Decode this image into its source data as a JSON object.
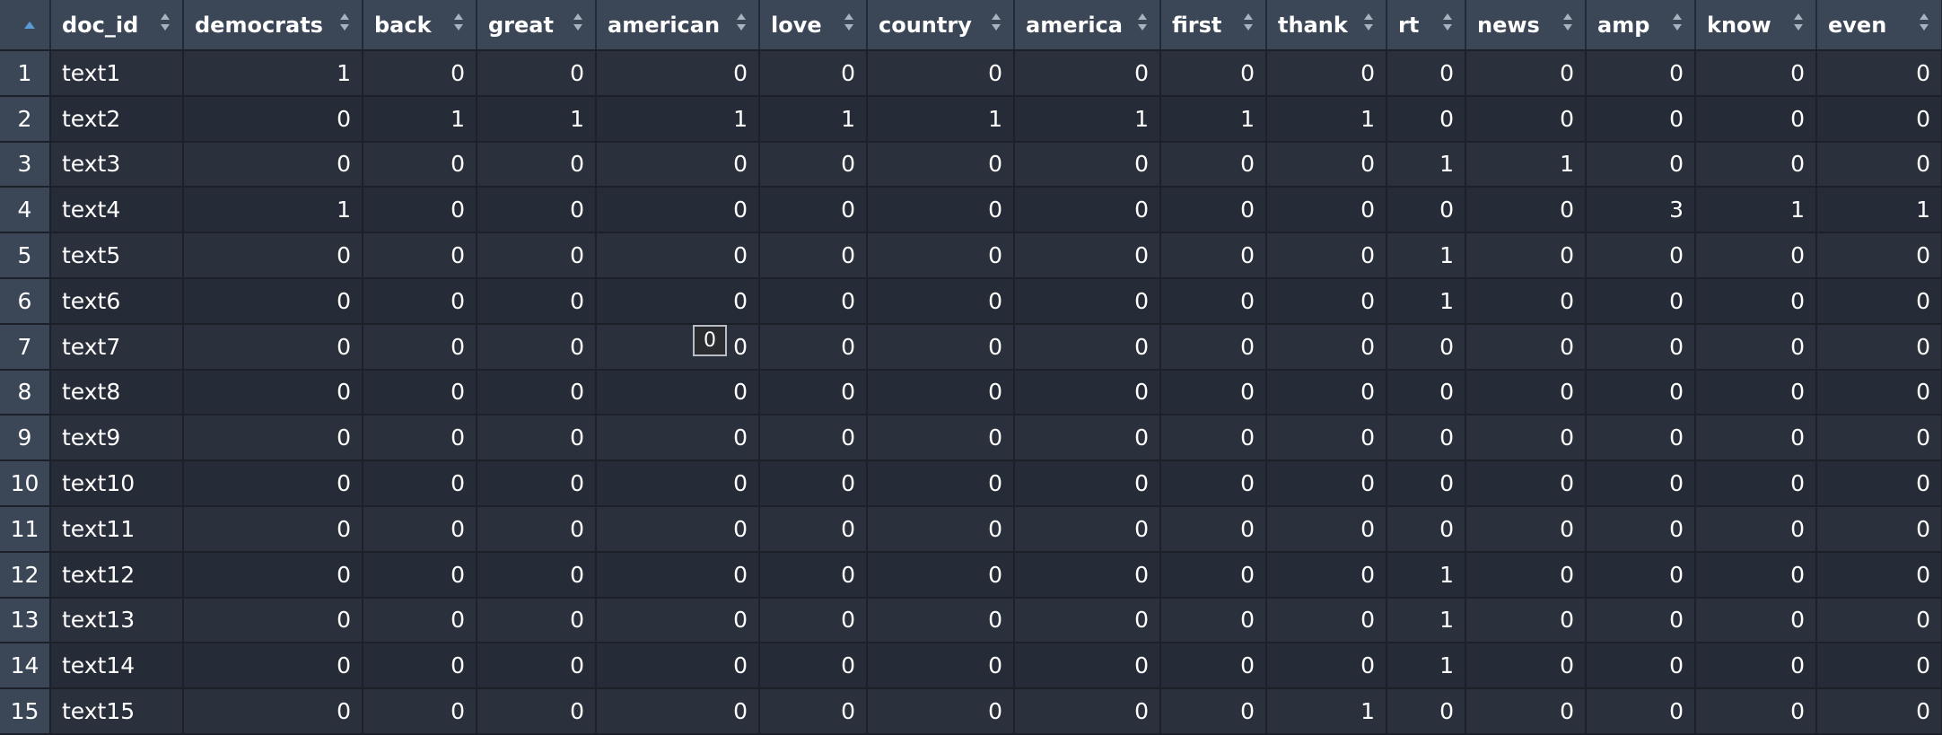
{
  "columns": [
    "doc_id",
    "democrats",
    "back",
    "great",
    "american",
    "love",
    "country",
    "america",
    "first",
    "thank",
    "rt",
    "news",
    "amp",
    "know",
    "even"
  ],
  "rows": [
    {
      "num": "1",
      "doc_id": "text1",
      "vals": [
        "1",
        "0",
        "0",
        "0",
        "0",
        "0",
        "0",
        "0",
        "0",
        "0",
        "0",
        "0",
        "0",
        "0"
      ]
    },
    {
      "num": "2",
      "doc_id": "text2",
      "vals": [
        "0",
        "1",
        "1",
        "1",
        "1",
        "1",
        "1",
        "1",
        "1",
        "0",
        "0",
        "0",
        "0",
        "0"
      ]
    },
    {
      "num": "3",
      "doc_id": "text3",
      "vals": [
        "0",
        "0",
        "0",
        "0",
        "0",
        "0",
        "0",
        "0",
        "0",
        "1",
        "1",
        "0",
        "0",
        "0"
      ]
    },
    {
      "num": "4",
      "doc_id": "text4",
      "vals": [
        "1",
        "0",
        "0",
        "0",
        "0",
        "0",
        "0",
        "0",
        "0",
        "0",
        "0",
        "3",
        "1",
        "1"
      ]
    },
    {
      "num": "5",
      "doc_id": "text5",
      "vals": [
        "0",
        "0",
        "0",
        "0",
        "0",
        "0",
        "0",
        "0",
        "0",
        "1",
        "0",
        "0",
        "0",
        "0"
      ]
    },
    {
      "num": "6",
      "doc_id": "text6",
      "vals": [
        "0",
        "0",
        "0",
        "0",
        "0",
        "0",
        "0",
        "0",
        "0",
        "1",
        "0",
        "0",
        "0",
        "0"
      ]
    },
    {
      "num": "7",
      "doc_id": "text7",
      "vals": [
        "0",
        "0",
        "0",
        "0",
        "0",
        "0",
        "0",
        "0",
        "0",
        "0",
        "0",
        "0",
        "0",
        "0"
      ]
    },
    {
      "num": "8",
      "doc_id": "text8",
      "vals": [
        "0",
        "0",
        "0",
        "0",
        "0",
        "0",
        "0",
        "0",
        "0",
        "0",
        "0",
        "0",
        "0",
        "0"
      ]
    },
    {
      "num": "9",
      "doc_id": "text9",
      "vals": [
        "0",
        "0",
        "0",
        "0",
        "0",
        "0",
        "0",
        "0",
        "0",
        "0",
        "0",
        "0",
        "0",
        "0"
      ]
    },
    {
      "num": "10",
      "doc_id": "text10",
      "vals": [
        "0",
        "0",
        "0",
        "0",
        "0",
        "0",
        "0",
        "0",
        "0",
        "0",
        "0",
        "0",
        "0",
        "0"
      ]
    },
    {
      "num": "11",
      "doc_id": "text11",
      "vals": [
        "0",
        "0",
        "0",
        "0",
        "0",
        "0",
        "0",
        "0",
        "0",
        "0",
        "0",
        "0",
        "0",
        "0"
      ]
    },
    {
      "num": "12",
      "doc_id": "text12",
      "vals": [
        "0",
        "0",
        "0",
        "0",
        "0",
        "0",
        "0",
        "0",
        "0",
        "1",
        "0",
        "0",
        "0",
        "0"
      ]
    },
    {
      "num": "13",
      "doc_id": "text13",
      "vals": [
        "0",
        "0",
        "0",
        "0",
        "0",
        "0",
        "0",
        "0",
        "0",
        "1",
        "0",
        "0",
        "0",
        "0"
      ]
    },
    {
      "num": "14",
      "doc_id": "text14",
      "vals": [
        "0",
        "0",
        "0",
        "0",
        "0",
        "0",
        "0",
        "0",
        "0",
        "1",
        "0",
        "0",
        "0",
        "0"
      ]
    },
    {
      "num": "15",
      "doc_id": "text15",
      "vals": [
        "0",
        "0",
        "0",
        "0",
        "0",
        "0",
        "0",
        "0",
        "1",
        "0",
        "0",
        "0",
        "0",
        "0"
      ]
    }
  ],
  "cell_editor": {
    "value": "0"
  },
  "sort": {
    "active_color": "#5b9bd5",
    "inactive_color": "#aab2bf"
  }
}
